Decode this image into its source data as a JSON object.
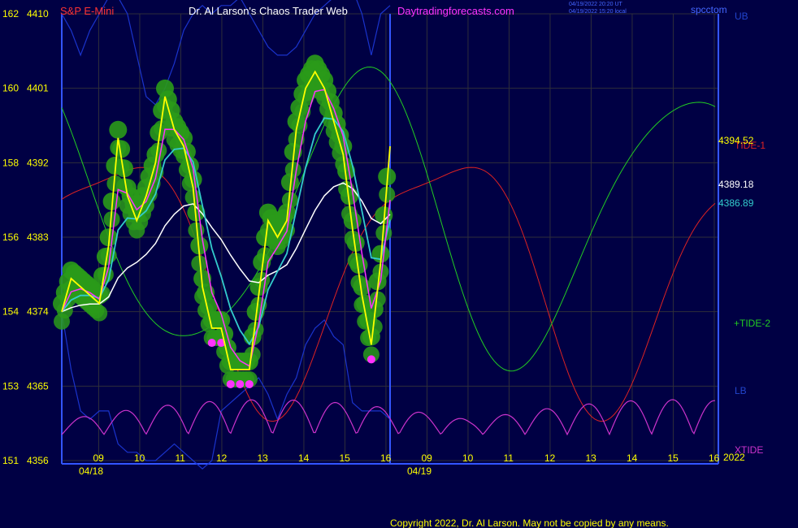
{
  "header": {
    "instrument": "S&P E-Mini",
    "title": "Dr. Al Larson's Chaos Trader Web",
    "site": "Daytradingforecasts.com",
    "timestamp_ut": "04/19/2022 20:20 UT",
    "timestamp_local": "04/19/2022 15:20 local",
    "brand": "spcctom"
  },
  "footer": {
    "copyright": "Copyright 2022, Dr. Al Larson. May not be copied by any means."
  },
  "colors": {
    "background": "#000044",
    "grid": "#2e2e3a",
    "price": "#ffff00",
    "ema_fast": "#ff33ff",
    "ema_white": "#ffffff",
    "ema_cyan": "#33cccc",
    "tide1": "#dd2222",
    "tide2": "#22cc22",
    "xtide": "#cc33cc",
    "bands": "#1a33cc",
    "bubbles": "#2a9a1a"
  },
  "chart_data": {
    "type": "line",
    "title": "S&P E-Mini",
    "y_left_ticks": [
      "151",
      "153",
      "154",
      "156",
      "158",
      "160",
      "162"
    ],
    "y_right_ticks": [
      "4356",
      "4365",
      "4374",
      "4383",
      "4392",
      "4401",
      "4410"
    ],
    "ylim": [
      4356,
      4410
    ],
    "x_ticks_day1": [
      "09",
      "10",
      "11",
      "12",
      "13",
      "14",
      "15",
      "16"
    ],
    "x_ticks_day2": [
      "09",
      "10",
      "11",
      "12",
      "13",
      "14",
      "15",
      "16"
    ],
    "dates": [
      "04/18",
      "04/19"
    ],
    "year_label": "2022",
    "last_values": {
      "price": "4394.52",
      "ema_white": "4389.18",
      "ema_cyan": "4386.89"
    },
    "series_labels": [
      "UB",
      "TIDE-1",
      "+TIDE-2",
      "LB",
      "XTIDE"
    ],
    "series": [
      {
        "name": "price",
        "values": [
          4374,
          4378,
          4377,
          4376,
          4375,
          4382,
          4395,
          4388,
          4385,
          4388,
          4392,
          4400,
          4396,
          4394,
          4389,
          4377,
          4372,
          4372,
          4367,
          4367,
          4367,
          4376,
          4385,
          4383,
          4385,
          4396,
          4401,
          4403,
          4401,
          4397,
          4393,
          4384,
          4376,
          4370,
          4380,
          4394
        ]
      },
      {
        "name": "UB",
        "values": [
          4410,
          4408,
          4405,
          4408,
          4410,
          4412,
          4412,
          4410,
          4405,
          4400,
          4399,
          4401,
          4404,
          4408,
          4410,
          4411,
          4410,
          4411,
          4411,
          4412,
          4410,
          4408,
          4406,
          4405,
          4405,
          4406,
          4408,
          4410,
          4411,
          4412,
          4412,
          4413,
          4410,
          4405,
          4410,
          4411
        ]
      },
      {
        "name": "LB",
        "values": [
          4374,
          4367,
          4362,
          4361,
          4362,
          4362,
          4358,
          4357,
          4357,
          4356,
          4356,
          4357,
          4358,
          4357,
          4356,
          4355,
          4356,
          4362,
          4363,
          4364,
          4365,
          4366,
          4364,
          4361,
          4364,
          4366,
          4370,
          4372,
          4373,
          4371,
          4370,
          4363,
          4362,
          4362,
          4362,
          4361
        ]
      }
    ]
  }
}
